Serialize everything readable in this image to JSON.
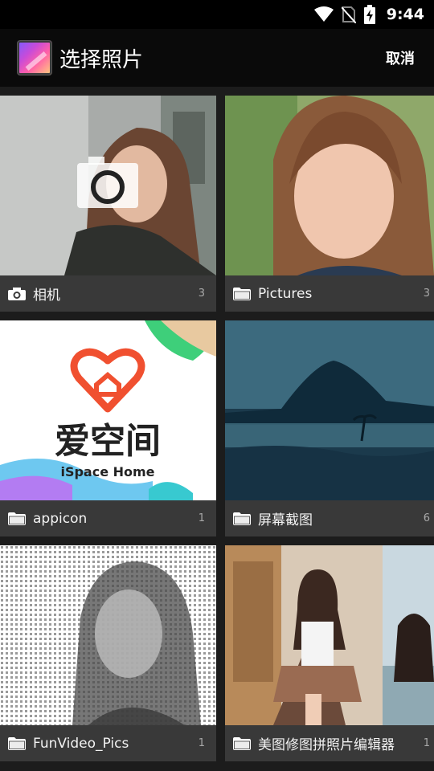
{
  "status_bar": {
    "time": "9:44"
  },
  "app_bar": {
    "title": "选择照片",
    "cancel_label": "取消"
  },
  "albums": [
    {
      "name": "相机",
      "count": "3",
      "icon": "camera-icon"
    },
    {
      "name": "Pictures",
      "count": "3",
      "icon": "folder-icon"
    },
    {
      "name": "appicon",
      "count": "1",
      "icon": "folder-icon",
      "thumb_text": "爱空间",
      "thumb_subtext": "iSpace Home"
    },
    {
      "name": "屏幕截图",
      "count": "6",
      "icon": "folder-icon"
    },
    {
      "name": "FunVideo_Pics",
      "count": "1",
      "icon": "folder-icon"
    },
    {
      "name": "美图修图拼照片编辑器",
      "count": "1",
      "icon": "folder-icon"
    }
  ]
}
